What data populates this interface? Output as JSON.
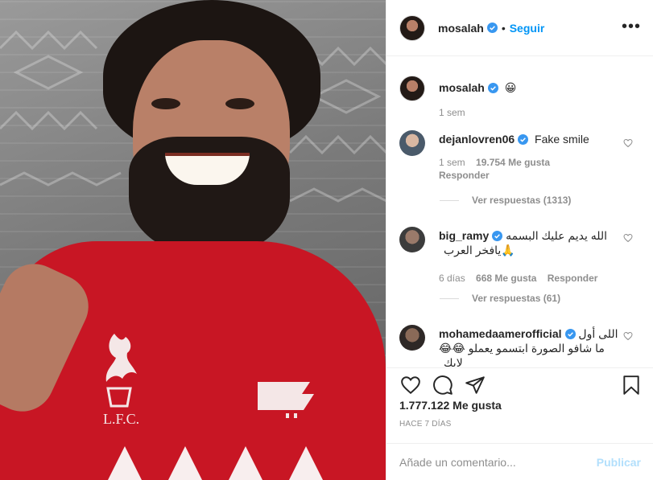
{
  "header": {
    "username": "mosalah",
    "separator": "•",
    "follow_label": "Seguir",
    "more_label": "•••"
  },
  "caption": {
    "username": "mosalah",
    "text": "😀",
    "time": "1 sem"
  },
  "comments": [
    {
      "username": "dejanlovren06",
      "text": "Fake smile",
      "time": "1 sem",
      "likes": "19.754 Me gusta",
      "reply_label": "Responder",
      "view_replies": "Ver respuestas (1313)"
    },
    {
      "username": "big_ramy",
      "text": "الله يديم عليك البسمه 🙏يافخر العرب",
      "time": "6 días",
      "likes": "668 Me gusta",
      "reply_label": "Responder",
      "view_replies": "Ver respuestas (61)"
    },
    {
      "username": "mohamedaamerofficial",
      "text": "اللى أول ما شافو الصورة ابتسمو يعملو 😂😂 لايك"
    }
  ],
  "likes": "1.777.122 Me gusta",
  "date": "HACE 7 DÍAS",
  "add_comment": {
    "placeholder": "Añade un comentario...",
    "publish_label": "Publicar"
  },
  "colors": {
    "accent": "#0095f6",
    "publish_disabled": "#b2dffc",
    "verified": "#3897f0",
    "shirt": "#c81624"
  },
  "icons": [
    "verified-icon",
    "more-icon",
    "heart-icon",
    "comment-icon",
    "share-icon",
    "bookmark-icon"
  ]
}
